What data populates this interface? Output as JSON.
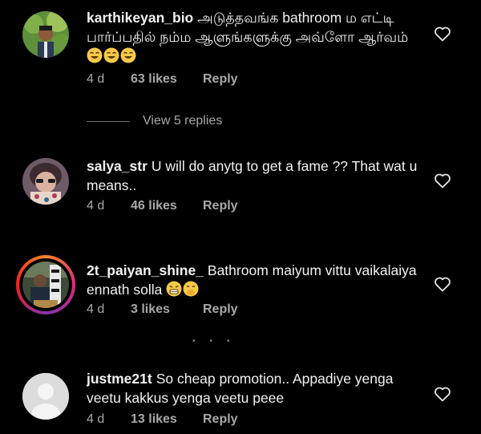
{
  "comments": [
    {
      "username": "karthikeyan_bio",
      "text": "அடுத்தவங்க bathroom ம எட்டி பார்ப்பதில் நம்ம ஆளுங்களுக்கு அவ்ளோ ஆர்வம்",
      "emojis": [
        "laughing-emoji",
        "laughing-emoji",
        "laughing-emoji"
      ],
      "time": "4 d",
      "likes": "63 likes",
      "reply": "Reply"
    },
    {
      "username": "salya_str",
      "text": "U will do anytg to get a fame ?? That wat u means..",
      "time": "4 d",
      "likes": "46 likes",
      "reply": "Reply"
    },
    {
      "username": "2t_paiyan_shine_",
      "text": "Bathroom maiyum vittu vaikalaiya ennath solla",
      "emojis": [
        "grimace-emoji",
        "hand-over-mouth-emoji"
      ],
      "time": "4 d",
      "likes": "3 likes",
      "reply": "Reply"
    },
    {
      "username": "justme21t",
      "text": "So cheap promotion.. Appadiye yenga veetu kakkus yenga veetu peee",
      "time": "4 d",
      "likes": "13 likes",
      "reply": "Reply"
    }
  ],
  "view_replies": "View 5 replies",
  "icons": {
    "like": "heart-outline-icon",
    "default_avatar": "default-avatar-icon"
  },
  "colors": {
    "background": "#000000",
    "text": "#f2f2f2",
    "secondary": "#a8a8a8"
  }
}
